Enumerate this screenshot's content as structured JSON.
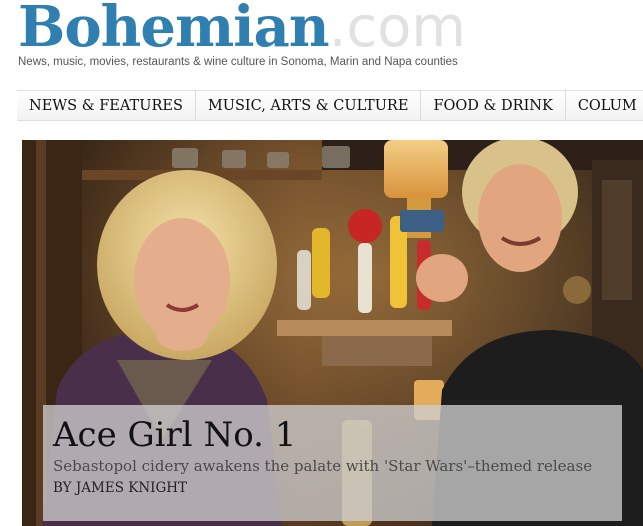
{
  "site": {
    "logo_main": "Bohemian",
    "logo_suffix": ".com",
    "tagline": "News, music, movies, restaurants & wine culture in Sonoma, Marin and Napa counties"
  },
  "nav": {
    "items": [
      {
        "label": "NEWS & FEATURES"
      },
      {
        "label": "MUSIC, ARTS & CULTURE"
      },
      {
        "label": "FOOD & DRINK"
      },
      {
        "label": "COLUM"
      }
    ]
  },
  "feature": {
    "headline": "Ace Girl No. 1",
    "deck": "Sebastopol cidery awakens the palate with 'Star Wars'–themed release",
    "byline": "BY JAMES KNIGHT"
  },
  "colors": {
    "brand_blue": "#2f7fb0",
    "suffix_gray": "#e1e1e1",
    "caption_bg": "#cdcdcd"
  }
}
